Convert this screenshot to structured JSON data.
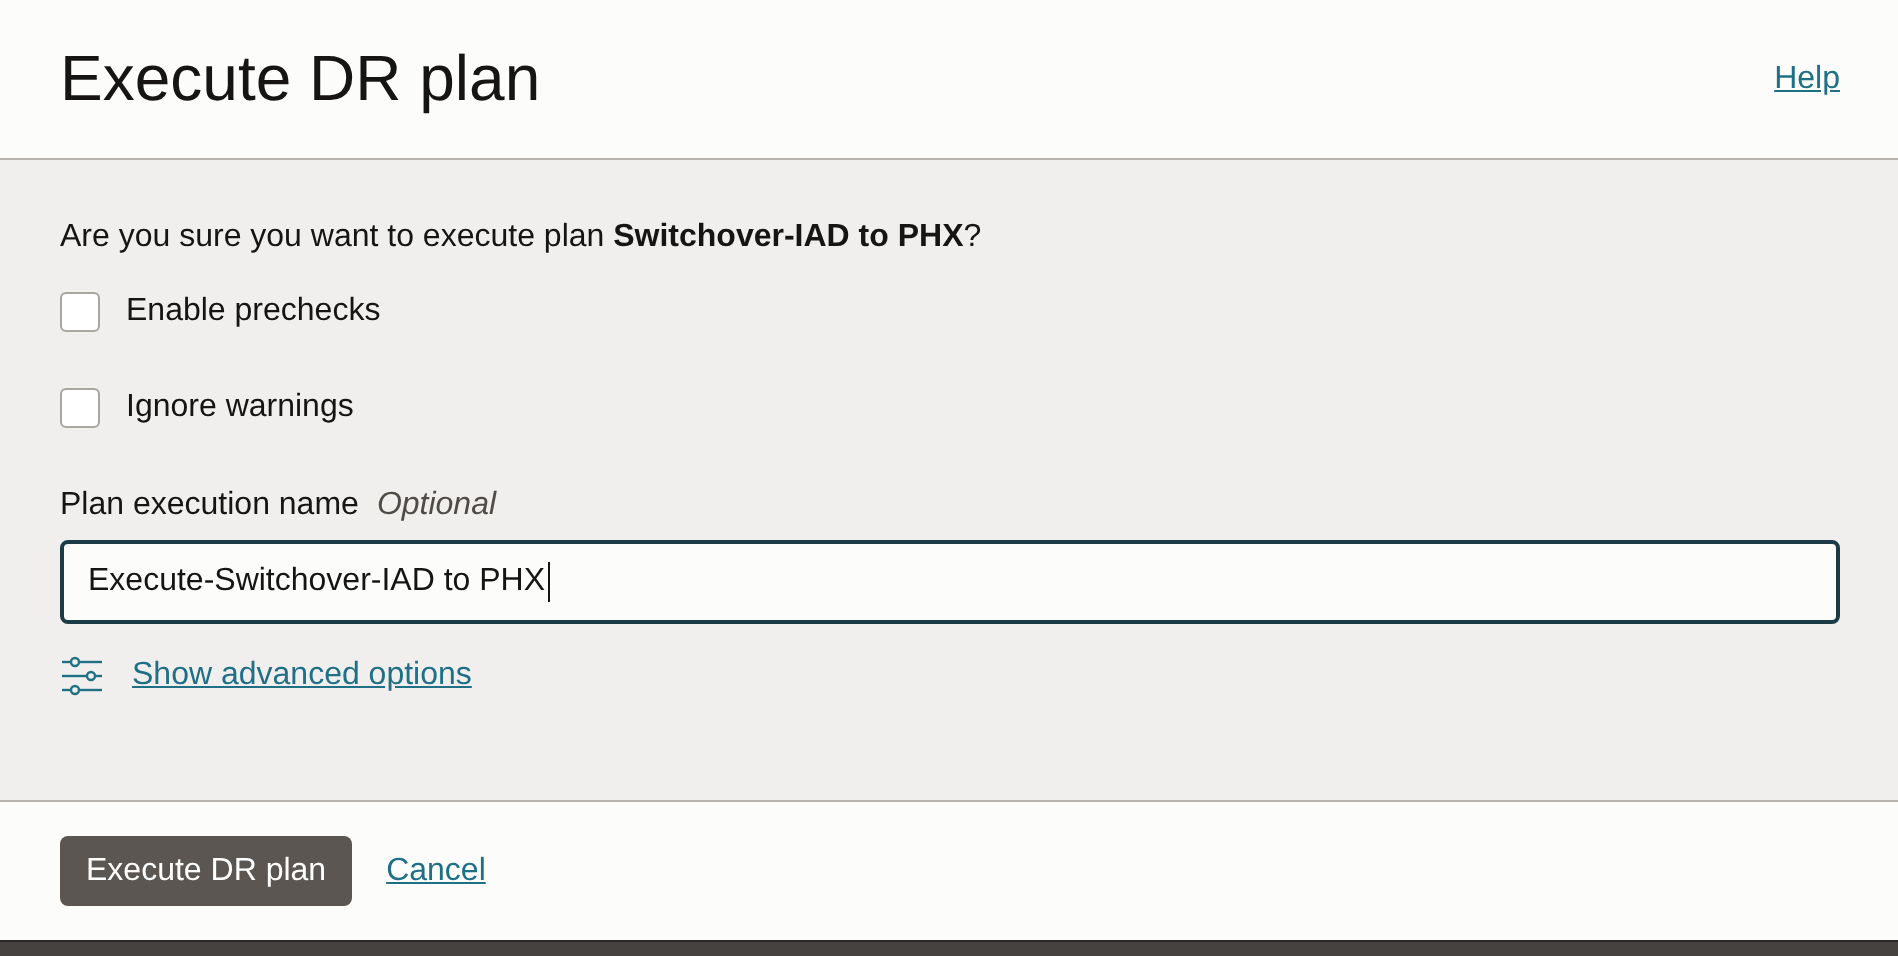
{
  "dialog": {
    "title": "Execute DR plan",
    "help_link": "Help"
  },
  "prompt": "Are you sure you want to execute plan **Switchover-IAD to PHX**?",
  "checkboxes": [
    {
      "label": "Enable prechecks",
      "checked": false
    },
    {
      "label": "Ignore warnings",
      "checked": false
    }
  ],
  "name_field": {
    "label": "Plan execution name",
    "hint": "Optional",
    "value": "Execute-Switchover-IAD to PHX",
    "focused": true
  },
  "advanced_link": "Show advanced options",
  "buttons": {
    "primary": "Execute DR plan",
    "cancel": "Cancel"
  }
}
